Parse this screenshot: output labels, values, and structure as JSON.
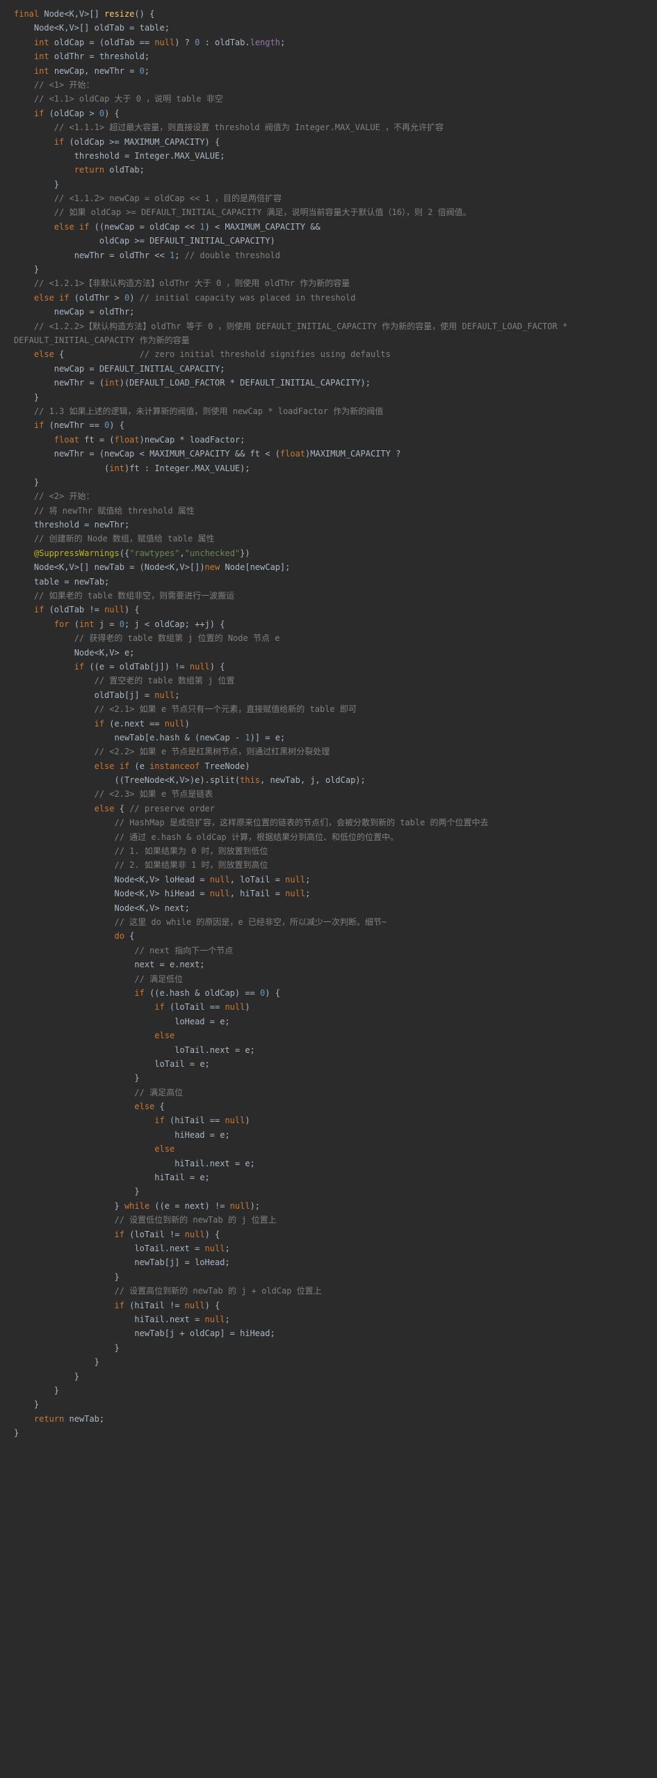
{
  "code": [
    {
      "i": 0,
      "t": [
        {
          "c": "kw",
          "s": "final"
        },
        {
          "s": " Node<K,V>[] "
        },
        {
          "c": "mth",
          "s": "resize"
        },
        {
          "s": "() {"
        }
      ]
    },
    {
      "i": 1,
      "t": [
        {
          "s": "Node<K,V>[] oldTab = table;"
        }
      ]
    },
    {
      "i": 1,
      "t": [
        {
          "c": "kw",
          "s": "int"
        },
        {
          "s": " oldCap = (oldTab == "
        },
        {
          "c": "kw",
          "s": "null"
        },
        {
          "s": ") ? "
        },
        {
          "c": "num",
          "s": "0"
        },
        {
          "s": " : oldTab."
        },
        {
          "c": "fld",
          "s": "length"
        },
        {
          "s": ";"
        }
      ]
    },
    {
      "i": 1,
      "t": [
        {
          "c": "kw",
          "s": "int"
        },
        {
          "s": " oldThr = threshold;"
        }
      ]
    },
    {
      "i": 1,
      "t": [
        {
          "c": "kw",
          "s": "int"
        },
        {
          "s": " newCap, newThr = "
        },
        {
          "c": "num",
          "s": "0"
        },
        {
          "s": ";"
        }
      ]
    },
    {
      "i": 1,
      "t": [
        {
          "c": "cm",
          "s": "// <1> 开始："
        }
      ]
    },
    {
      "i": 1,
      "t": [
        {
          "c": "cm",
          "s": "// <1.1> oldCap 大于 0 ，说明 table 非空"
        }
      ]
    },
    {
      "i": 1,
      "t": [
        {
          "c": "kw",
          "s": "if"
        },
        {
          "s": " (oldCap > "
        },
        {
          "c": "num",
          "s": "0"
        },
        {
          "s": ") {"
        }
      ]
    },
    {
      "i": 2,
      "t": [
        {
          "c": "cm",
          "s": "// <1.1.1> 超过最大容量，则直接设置 threshold 阀值为 Integer.MAX_VALUE ，不再允许扩容"
        }
      ]
    },
    {
      "i": 2,
      "t": [
        {
          "c": "kw",
          "s": "if"
        },
        {
          "s": " (oldCap >= MAXIMUM_CAPACITY) {"
        }
      ]
    },
    {
      "i": 3,
      "t": [
        {
          "s": "threshold = "
        },
        {
          "c": "cls",
          "s": "Integer"
        },
        {
          "s": ".MAX_VALUE;"
        }
      ]
    },
    {
      "i": 3,
      "t": [
        {
          "c": "kw",
          "s": "return"
        },
        {
          "s": " oldTab;"
        }
      ]
    },
    {
      "i": 2,
      "t": [
        {
          "s": "}"
        }
      ]
    },
    {
      "i": 2,
      "t": [
        {
          "c": "cm",
          "s": "// <1.1.2> newCap = oldCap << 1 ，目的是两倍扩容"
        }
      ]
    },
    {
      "i": 2,
      "t": [
        {
          "c": "cm",
          "s": "// 如果 oldCap >= DEFAULT_INITIAL_CAPACITY 满足，说明当前容量大于默认值（16），则 2 倍阀值。"
        }
      ]
    },
    {
      "i": 2,
      "t": [
        {
          "c": "kw",
          "s": "else if"
        },
        {
          "s": " ((newCap = oldCap << "
        },
        {
          "c": "num",
          "s": "1"
        },
        {
          "s": ") < MAXIMUM_CAPACITY &&"
        }
      ]
    },
    {
      "i": 4,
      "t": [
        {
          "s": " oldCap >= DEFAULT_INITIAL_CAPACITY)"
        }
      ]
    },
    {
      "i": 3,
      "t": [
        {
          "s": "newThr = oldThr << "
        },
        {
          "c": "num",
          "s": "1"
        },
        {
          "s": "; "
        },
        {
          "c": "cm",
          "s": "// double threshold"
        }
      ]
    },
    {
      "i": 1,
      "t": [
        {
          "s": "}"
        }
      ]
    },
    {
      "i": 1,
      "t": [
        {
          "c": "cm",
          "s": "// <1.2.1>【非默认构造方法】oldThr 大于 0 ，则使用 oldThr 作为新的容量"
        }
      ]
    },
    {
      "i": 1,
      "t": [
        {
          "c": "kw",
          "s": "else if"
        },
        {
          "s": " (oldThr > "
        },
        {
          "c": "num",
          "s": "0"
        },
        {
          "s": ") "
        },
        {
          "c": "cm",
          "s": "// initial capacity was placed in threshold"
        }
      ]
    },
    {
      "i": 2,
      "t": [
        {
          "s": "newCap = oldThr;"
        }
      ]
    },
    {
      "i": 1,
      "t": [
        {
          "c": "cm",
          "s": "// <1.2.2>【默认构造方法】oldThr 等于 0 ，则使用 DEFAULT_INITIAL_CAPACITY 作为新的容量，使用 DEFAULT_LOAD_FACTOR * "
        }
      ]
    },
    {
      "i": -1,
      "t": [
        {
          "c": "cm",
          "s": "DEFAULT_INITIAL_CAPACITY 作为新的容量"
        }
      ]
    },
    {
      "i": 1,
      "t": [
        {
          "c": "kw",
          "s": "else"
        },
        {
          "s": " {               "
        },
        {
          "c": "cm",
          "s": "// zero initial threshold signifies using defaults"
        }
      ]
    },
    {
      "i": 2,
      "t": [
        {
          "s": "newCap = DEFAULT_INITIAL_CAPACITY;"
        }
      ]
    },
    {
      "i": 2,
      "t": [
        {
          "s": "newThr = ("
        },
        {
          "c": "kw",
          "s": "int"
        },
        {
          "s": ")(DEFAULT_LOAD_FACTOR * DEFAULT_INITIAL_CAPACITY);"
        }
      ]
    },
    {
      "i": 1,
      "t": [
        {
          "s": "}"
        }
      ]
    },
    {
      "i": 1,
      "t": [
        {
          "c": "cm",
          "s": "// 1.3 如果上述的逻辑，未计算新的阀值，则使用 newCap * loadFactor 作为新的阀值"
        }
      ]
    },
    {
      "i": 1,
      "t": [
        {
          "c": "kw",
          "s": "if"
        },
        {
          "s": " (newThr == "
        },
        {
          "c": "num",
          "s": "0"
        },
        {
          "s": ") {"
        }
      ]
    },
    {
      "i": 2,
      "t": [
        {
          "c": "kw",
          "s": "float"
        },
        {
          "s": " ft = ("
        },
        {
          "c": "kw",
          "s": "float"
        },
        {
          "s": ")newCap * loadFactor;"
        }
      ]
    },
    {
      "i": 2,
      "t": [
        {
          "s": "newThr = (newCap < MAXIMUM_CAPACITY && ft < ("
        },
        {
          "c": "kw",
          "s": "float"
        },
        {
          "s": ")MAXIMUM_CAPACITY ?"
        }
      ]
    },
    {
      "i": 4,
      "t": [
        {
          "s": "  ("
        },
        {
          "c": "kw",
          "s": "int"
        },
        {
          "s": ")ft : "
        },
        {
          "c": "cls",
          "s": "Integer"
        },
        {
          "s": ".MAX_VALUE);"
        }
      ]
    },
    {
      "i": 1,
      "t": [
        {
          "s": "}"
        }
      ]
    },
    {
      "i": 1,
      "t": [
        {
          "c": "cm",
          "s": "// <2> 开始："
        }
      ]
    },
    {
      "i": 1,
      "t": [
        {
          "c": "cm",
          "s": "// 将 newThr 赋值给 threshold 属性"
        }
      ]
    },
    {
      "i": 1,
      "t": [
        {
          "s": "threshold = newThr;"
        }
      ]
    },
    {
      "i": 1,
      "t": [
        {
          "c": "cm",
          "s": "// 创建新的 Node 数组，赋值给 table 属性"
        }
      ]
    },
    {
      "i": 1,
      "t": [
        {
          "c": "ann",
          "s": "@SuppressWarnings"
        },
        {
          "s": "({"
        },
        {
          "c": "str",
          "s": "\"rawtypes\""
        },
        {
          "s": ","
        },
        {
          "c": "str",
          "s": "\"unchecked\""
        },
        {
          "s": "})"
        }
      ]
    },
    {
      "i": 1,
      "t": [
        {
          "s": "Node<K,V>[] newTab = (Node<K,V>[])"
        },
        {
          "c": "kw",
          "s": "new"
        },
        {
          "s": " Node[newCap];"
        }
      ]
    },
    {
      "i": 1,
      "t": [
        {
          "s": "table = newTab;"
        }
      ]
    },
    {
      "i": 1,
      "t": [
        {
          "c": "cm",
          "s": "// 如果老的 table 数组非空，则需要进行一波搬运"
        }
      ]
    },
    {
      "i": 1,
      "t": [
        {
          "c": "kw",
          "s": "if"
        },
        {
          "s": " (oldTab != "
        },
        {
          "c": "kw",
          "s": "null"
        },
        {
          "s": ") {"
        }
      ]
    },
    {
      "i": 2,
      "t": [
        {
          "c": "kw",
          "s": "for"
        },
        {
          "s": " ("
        },
        {
          "c": "kw",
          "s": "int"
        },
        {
          "s": " j = "
        },
        {
          "c": "num",
          "s": "0"
        },
        {
          "s": "; j < oldCap; ++j) {"
        }
      ]
    },
    {
      "i": 3,
      "t": [
        {
          "c": "cm",
          "s": "// 获得老的 table 数组第 j 位置的 Node 节点 e"
        }
      ]
    },
    {
      "i": 3,
      "t": [
        {
          "s": "Node<K,V> e;"
        }
      ]
    },
    {
      "i": 3,
      "t": [
        {
          "c": "kw",
          "s": "if"
        },
        {
          "s": " ((e = oldTab[j]) != "
        },
        {
          "c": "kw",
          "s": "null"
        },
        {
          "s": ") {"
        }
      ]
    },
    {
      "i": 4,
      "t": [
        {
          "c": "cm",
          "s": "// 置空老的 table 数组第 j 位置"
        }
      ]
    },
    {
      "i": 4,
      "t": [
        {
          "s": "oldTab[j] = "
        },
        {
          "c": "kw",
          "s": "null"
        },
        {
          "s": ";"
        }
      ]
    },
    {
      "i": 4,
      "t": [
        {
          "c": "cm",
          "s": "// <2.1> 如果 e 节点只有一个元素，直接赋值给新的 table 即可"
        }
      ]
    },
    {
      "i": 4,
      "t": [
        {
          "c": "kw",
          "s": "if"
        },
        {
          "s": " (e.next == "
        },
        {
          "c": "kw",
          "s": "null"
        },
        {
          "s": ")"
        }
      ]
    },
    {
      "i": 5,
      "t": [
        {
          "s": "newTab[e.hash & (newCap - "
        },
        {
          "c": "num",
          "s": "1"
        },
        {
          "s": ")] = e;"
        }
      ]
    },
    {
      "i": 4,
      "t": [
        {
          "c": "cm",
          "s": "// <2.2> 如果 e 节点是红黑树节点，则通过红黑树分裂处理"
        }
      ]
    },
    {
      "i": 4,
      "t": [
        {
          "c": "kw",
          "s": "else if"
        },
        {
          "s": " (e "
        },
        {
          "c": "kw",
          "s": "instanceof"
        },
        {
          "s": " TreeNode)"
        }
      ]
    },
    {
      "i": 5,
      "t": [
        {
          "s": "((TreeNode<K,V>)e).split("
        },
        {
          "c": "kw",
          "s": "this"
        },
        {
          "s": ", newTab, j, oldCap);"
        }
      ]
    },
    {
      "i": 4,
      "t": [
        {
          "c": "cm",
          "s": "// <2.3> 如果 e 节点是链表"
        }
      ]
    },
    {
      "i": 4,
      "t": [
        {
          "c": "kw",
          "s": "else"
        },
        {
          "s": " { "
        },
        {
          "c": "cm",
          "s": "// preserve order"
        }
      ]
    },
    {
      "i": 5,
      "t": [
        {
          "c": "cm",
          "s": "// HashMap 是成倍扩容，这样原来位置的链表的节点们，会被分散到新的 table 的两个位置中去"
        }
      ]
    },
    {
      "i": 5,
      "t": [
        {
          "c": "cm",
          "s": "// 通过 e.hash & oldCap 计算，根据结果分到高位、和低位的位置中。"
        }
      ]
    },
    {
      "i": 5,
      "t": [
        {
          "c": "cm",
          "s": "// 1. 如果结果为 0 时，则放置到低位"
        }
      ]
    },
    {
      "i": 5,
      "t": [
        {
          "c": "cm",
          "s": "// 2. 如果结果非 1 时，则放置到高位"
        }
      ]
    },
    {
      "i": 5,
      "t": [
        {
          "s": "Node<K,V> loHead = "
        },
        {
          "c": "kw",
          "s": "null"
        },
        {
          "s": ", loTail = "
        },
        {
          "c": "kw",
          "s": "null"
        },
        {
          "s": ";"
        }
      ]
    },
    {
      "i": 5,
      "t": [
        {
          "s": "Node<K,V> hiHead = "
        },
        {
          "c": "kw",
          "s": "null"
        },
        {
          "s": ", hiTail = "
        },
        {
          "c": "kw",
          "s": "null"
        },
        {
          "s": ";"
        }
      ]
    },
    {
      "i": 5,
      "t": [
        {
          "s": "Node<K,V> next;"
        }
      ]
    },
    {
      "i": 5,
      "t": [
        {
          "c": "cm",
          "s": "// 这里 do while 的原因是，e 已经非空，所以减少一次判断。细节~"
        }
      ]
    },
    {
      "i": 5,
      "t": [
        {
          "c": "kw",
          "s": "do"
        },
        {
          "s": " {"
        }
      ]
    },
    {
      "i": 6,
      "t": [
        {
          "c": "cm",
          "s": "// next 指向下一个节点"
        }
      ]
    },
    {
      "i": 6,
      "t": [
        {
          "s": "next = e.next;"
        }
      ]
    },
    {
      "i": 6,
      "t": [
        {
          "c": "cm",
          "s": "// 满足低位"
        }
      ]
    },
    {
      "i": 6,
      "t": [
        {
          "c": "kw",
          "s": "if"
        },
        {
          "s": " ((e.hash & oldCap) == "
        },
        {
          "c": "num",
          "s": "0"
        },
        {
          "s": ") {"
        }
      ]
    },
    {
      "i": 7,
      "t": [
        {
          "c": "kw",
          "s": "if"
        },
        {
          "s": " (loTail == "
        },
        {
          "c": "kw",
          "s": "null"
        },
        {
          "s": ")"
        }
      ]
    },
    {
      "i": 8,
      "t": [
        {
          "s": "loHead = e;"
        }
      ]
    },
    {
      "i": 7,
      "t": [
        {
          "c": "kw",
          "s": "else"
        }
      ]
    },
    {
      "i": 8,
      "t": [
        {
          "s": "loTail.next = e;"
        }
      ]
    },
    {
      "i": 7,
      "t": [
        {
          "s": "loTail = e;"
        }
      ]
    },
    {
      "i": 6,
      "t": [
        {
          "s": "}"
        }
      ]
    },
    {
      "i": 6,
      "t": [
        {
          "c": "cm",
          "s": "// 满足高位"
        }
      ]
    },
    {
      "i": 6,
      "t": [
        {
          "c": "kw",
          "s": "else"
        },
        {
          "s": " {"
        }
      ]
    },
    {
      "i": 7,
      "t": [
        {
          "c": "kw",
          "s": "if"
        },
        {
          "s": " (hiTail == "
        },
        {
          "c": "kw",
          "s": "null"
        },
        {
          "s": ")"
        }
      ]
    },
    {
      "i": 8,
      "t": [
        {
          "s": "hiHead = e;"
        }
      ]
    },
    {
      "i": 7,
      "t": [
        {
          "c": "kw",
          "s": "else"
        }
      ]
    },
    {
      "i": 8,
      "t": [
        {
          "s": "hiTail.next = e;"
        }
      ]
    },
    {
      "i": 7,
      "t": [
        {
          "s": "hiTail = e;"
        }
      ]
    },
    {
      "i": 6,
      "t": [
        {
          "s": "}"
        }
      ]
    },
    {
      "i": 5,
      "t": [
        {
          "s": "} "
        },
        {
          "c": "kw",
          "s": "while"
        },
        {
          "s": " ((e = next) != "
        },
        {
          "c": "kw",
          "s": "null"
        },
        {
          "s": ");"
        }
      ]
    },
    {
      "i": 5,
      "t": [
        {
          "c": "cm",
          "s": "// 设置低位到新的 newTab 的 j 位置上"
        }
      ]
    },
    {
      "i": 5,
      "t": [
        {
          "c": "kw",
          "s": "if"
        },
        {
          "s": " (loTail != "
        },
        {
          "c": "kw",
          "s": "null"
        },
        {
          "s": ") {"
        }
      ]
    },
    {
      "i": 6,
      "t": [
        {
          "s": "loTail.next = "
        },
        {
          "c": "kw",
          "s": "null"
        },
        {
          "s": ";"
        }
      ]
    },
    {
      "i": 6,
      "t": [
        {
          "s": "newTab[j] = loHead;"
        }
      ]
    },
    {
      "i": 5,
      "t": [
        {
          "s": "}"
        }
      ]
    },
    {
      "i": 5,
      "t": [
        {
          "c": "cm",
          "s": "// 设置高位到新的 newTab 的 j + oldCap 位置上"
        }
      ]
    },
    {
      "i": 5,
      "t": [
        {
          "c": "kw",
          "s": "if"
        },
        {
          "s": " (hiTail != "
        },
        {
          "c": "kw",
          "s": "null"
        },
        {
          "s": ") {"
        }
      ]
    },
    {
      "i": 6,
      "t": [
        {
          "s": "hiTail.next = "
        },
        {
          "c": "kw",
          "s": "null"
        },
        {
          "s": ";"
        }
      ]
    },
    {
      "i": 6,
      "t": [
        {
          "s": "newTab[j + oldCap] = hiHead;"
        }
      ]
    },
    {
      "i": 5,
      "t": [
        {
          "s": "}"
        }
      ]
    },
    {
      "i": 4,
      "t": [
        {
          "s": "}"
        }
      ]
    },
    {
      "i": 3,
      "t": [
        {
          "s": "}"
        }
      ]
    },
    {
      "i": 2,
      "t": [
        {
          "s": "}"
        }
      ]
    },
    {
      "i": 1,
      "t": [
        {
          "s": "}"
        }
      ]
    },
    {
      "i": 1,
      "t": [
        {
          "c": "kw",
          "s": "return"
        },
        {
          "s": " newTab;"
        }
      ]
    },
    {
      "i": 0,
      "t": [
        {
          "s": "}"
        }
      ]
    }
  ]
}
